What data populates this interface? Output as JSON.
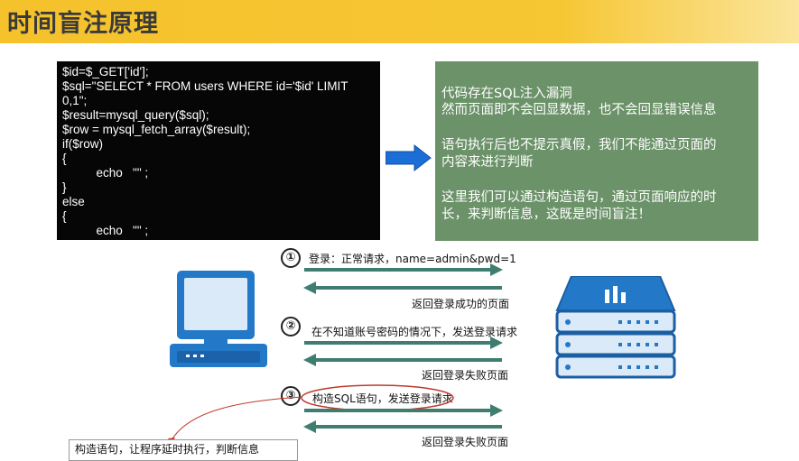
{
  "header": {
    "title": "时间盲注原理"
  },
  "code": {
    "lines": [
      "$id=$_GET['id'];",
      "$sql=\"SELECT * FROM users WHERE id='$id' LIMIT",
      "0,1\";",
      "$result=mysql_query($sql);",
      "$row = mysql_fetch_array($result);",
      "if($row)",
      "{",
      "          echo   \"\" ;",
      "}",
      "else",
      "{",
      "          echo   \"\" ;",
      "}"
    ]
  },
  "explanation": {
    "lines": [
      "代码存在SQL注入漏洞",
      "然而页面即不会回显数据，也不会回显错误信息",
      "语句执行后也不提示真假，我们不能通过页面的",
      "内容来进行判断",
      "这里我们可以通过构造语句，通过页面响应的时",
      "长，来判断信息，这既是时间盲注！"
    ]
  },
  "steps": [
    {
      "number": "①",
      "request": "登录：正常请求，name=admin&pwd=1",
      "response": "返回登录成功的页面"
    },
    {
      "number": "②",
      "request": "在不知道账号密码的情况下，发送登录请求",
      "response": "返回登录失败页面"
    },
    {
      "number": "③",
      "request": "构造SQL语句，发送登录请求",
      "response": "返回登录失败页面"
    }
  ],
  "note": {
    "text": "构造语句，让程序延时执行，判断信息"
  },
  "colors": {
    "title_bar": "#f5c22c",
    "green_box": "#6b9268",
    "arrow_blue": "#1a6ed6",
    "flow_arrow": "#3e7d6f",
    "device": "#2478c8",
    "ellipse": "#c0392b"
  }
}
